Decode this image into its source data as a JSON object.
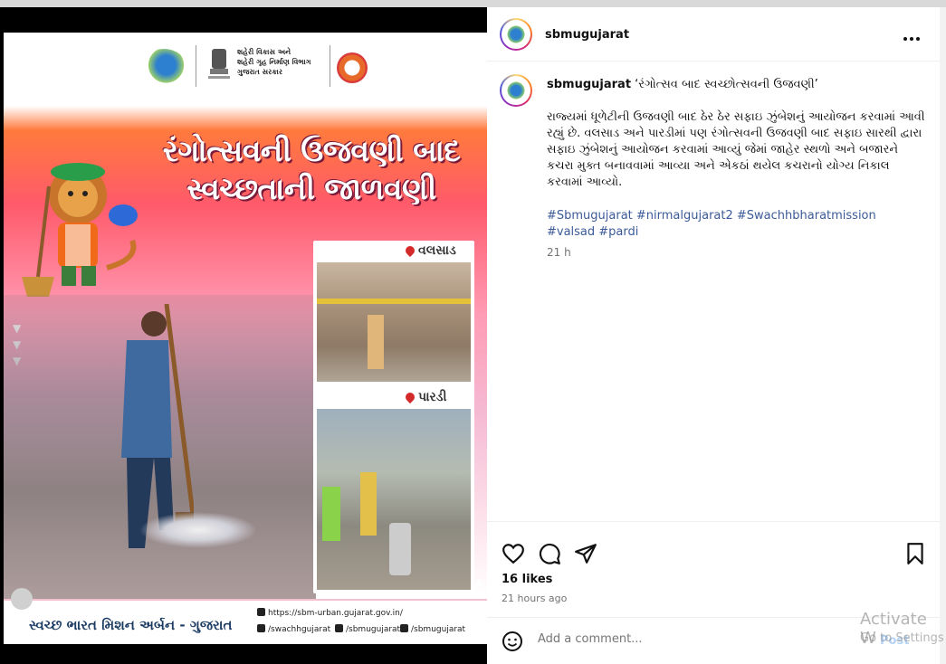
{
  "post": {
    "username": "sbmugujarat",
    "caption_title": "‘રંગોત્સવ બાદ સ્વચ્છોત્સવની ઉજવણી’",
    "caption_body": "રાજ્યમાં ધૂળેટીની ઉજવણી બાદ ઠેર ઠેર સફાઇ ઝુંબેશનું આયોજન કરવામાં આવી રહ્યું છે. વલસાડ અને પારડીમાં પણ રંગોત્સવની ઉજવણી બાદ સફાઇ સારથી દ્વારા સફાઇ ઝુંબેશનું આયોજન કરવામાં આવ્યું જેમાં જાહેર સ્થળો અને બજારને કચરા મુક્ત બનાવવામાં આવ્યા અને એકઠાં થયેલ કચરાનો યોગ્ય નિકાલ કરવામાં આવ્યો.",
    "hashtags": "#Sbmugujarat #nirmalgujarat2 #Swachhbharatmission #valsad #pardi",
    "time_ago": "21 h",
    "likes": "16 likes",
    "posted": "21 hours ago"
  },
  "comment": {
    "placeholder": "Add a comment...",
    "post_label": "Post"
  },
  "poster": {
    "header_dept": "શહેરી વિકાસ અને\nશહેરી ગૃહ નિર્માણ વિભાગ\nગુજરાત સરકાર",
    "headline_line1": "રંગોત્સવની ઉજવણી બાદ",
    "headline_line2": "સ્વચ્છતાની જાળવણી",
    "loc1": "વલસાડ",
    "loc2": "પારડી",
    "footer_title": "સ્વચ્છ ભારત મિશન અર્બન - ગુજરાત",
    "link_site": "https://sbm-urban.gujarat.gov.in/",
    "link_fb": "/swachhgujarat",
    "link_x": "/sbmugujarat",
    "link_ig": "/sbmugujarat"
  },
  "system": {
    "activate_line1": "Activate W",
    "activate_line2": "Go to Settings"
  },
  "icons": [
    "more-icon",
    "heart-icon",
    "comment-icon",
    "share-icon",
    "bookmark-icon",
    "emoji-icon",
    "location-pin-icon"
  ],
  "colors": {
    "link": "#3c5a99",
    "post_button": "#b6d3f5",
    "muted": "#737373"
  }
}
